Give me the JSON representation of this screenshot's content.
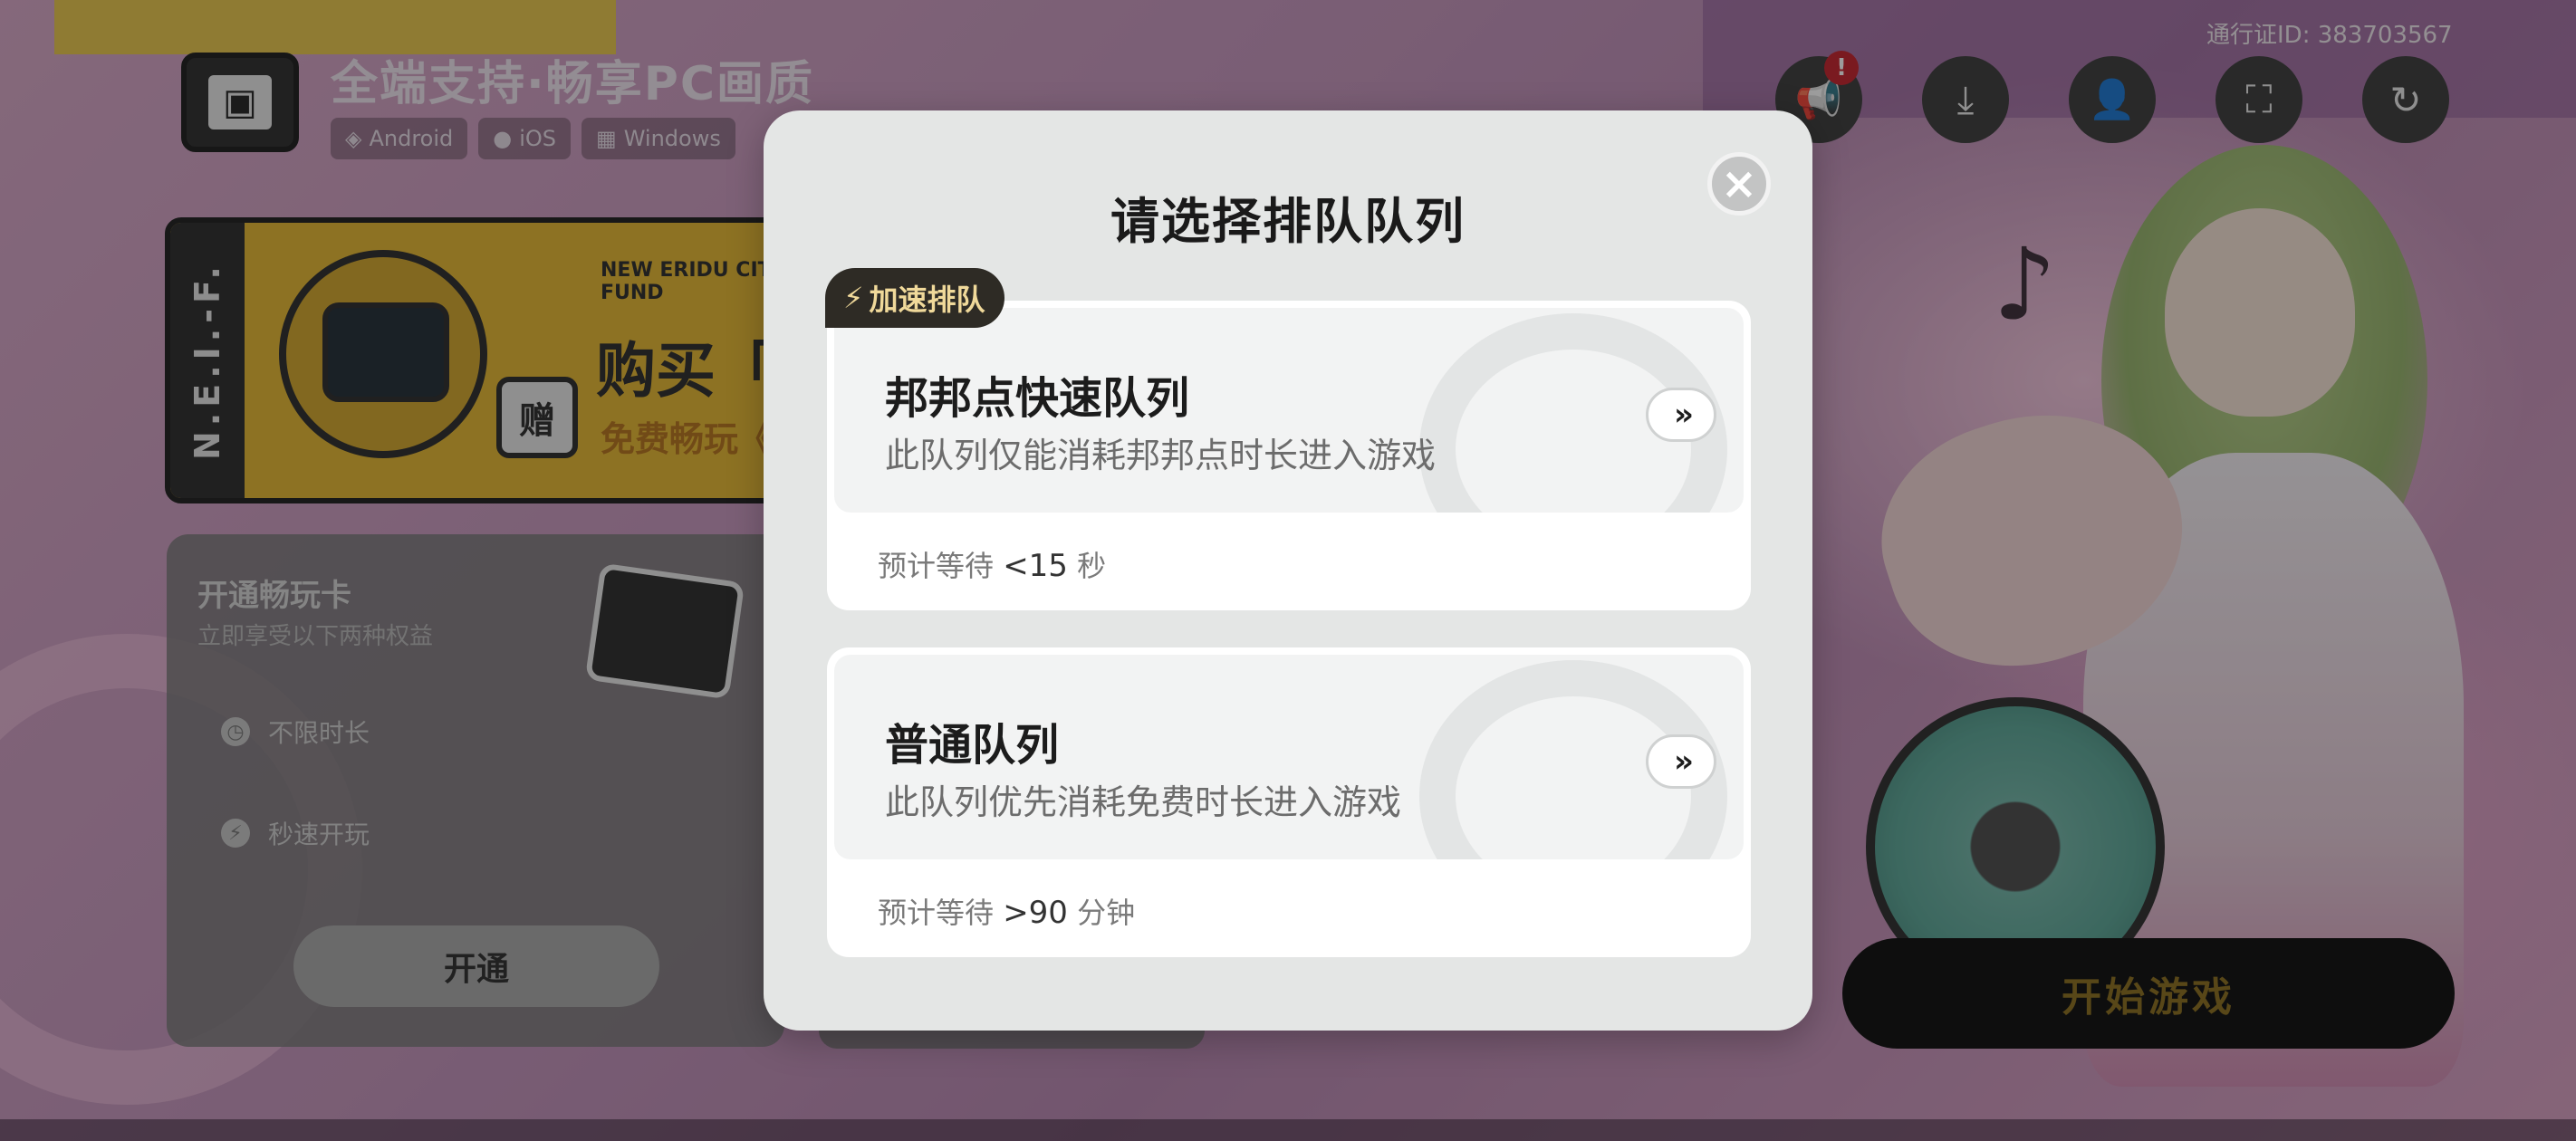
{
  "header": {
    "brand_title": "全端支持·畅享PC画质",
    "platforms": [
      "Android",
      "iOS",
      "Windows"
    ],
    "pass_id": "通行证ID: 383703567"
  },
  "toolbar_icons": [
    "announcement-icon",
    "download-icon",
    "user-icon",
    "scan-icon",
    "refresh-icon"
  ],
  "banner": {
    "side_text": "N.E.I.-F.",
    "fund_text": "NEW ERIDU CITY FUND",
    "buy_text": "购买「",
    "free_text": "免费畅玩《",
    "gift_badge": "赠"
  },
  "pass_card": {
    "title": "开通畅玩卡",
    "subtitle": "立即享受以下两种权益",
    "benefits": [
      "不限时长",
      "秒速开玩"
    ],
    "button_label": "开通"
  },
  "start_button_label": "开始游戏",
  "modal": {
    "title": "请选择排队队列",
    "close_symbol": "×",
    "accel_tag": "加速排队",
    "queues": [
      {
        "name": "邦邦点快速队列",
        "description": "此队列仅能消耗邦邦点时长进入游戏",
        "wait_label": "预计等待",
        "wait_value": "<15",
        "wait_unit": "秒"
      },
      {
        "name": "普通队列",
        "description": "此队列优先消耗免费时长进入游戏",
        "wait_label": "预计等待",
        "wait_value": ">90",
        "wait_unit": "分钟"
      }
    ]
  },
  "colors": {
    "modal_bg": "#e4e6e5",
    "accel_tag_bg": "#2e2b25",
    "accel_tag_text": "#f0d99a",
    "start_button_bg": "#0b0b0b",
    "start_button_text": "#8a6d1c"
  }
}
